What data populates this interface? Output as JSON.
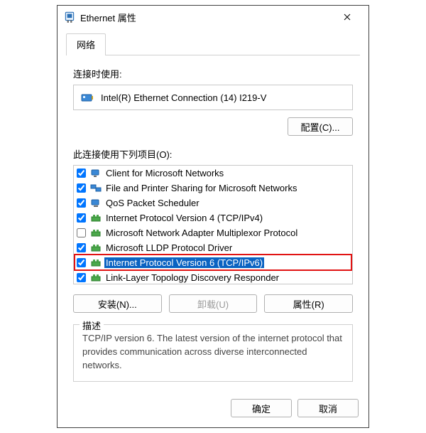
{
  "window": {
    "title": "Ethernet 属性",
    "close_tooltip": "关闭"
  },
  "tab": {
    "network": "网络"
  },
  "labels": {
    "connect_using": "连接时使用:",
    "this_connection_uses": "此连接使用下列项目(O):"
  },
  "adapter": {
    "name": "Intel(R) Ethernet Connection (14) I219-V"
  },
  "buttons": {
    "configure": "配置(C)...",
    "install": "安装(N)...",
    "uninstall": "卸载(U)",
    "properties": "属性(R)",
    "ok": "确定",
    "cancel": "取消"
  },
  "items": [
    {
      "label": "Client for Microsoft Networks",
      "checked": true,
      "icon": "client"
    },
    {
      "label": "File and Printer Sharing for Microsoft Networks",
      "checked": true,
      "icon": "share"
    },
    {
      "label": "QoS Packet Scheduler",
      "checked": true,
      "icon": "qos"
    },
    {
      "label": "Internet Protocol Version 4 (TCP/IPv4)",
      "checked": true,
      "icon": "proto"
    },
    {
      "label": "Microsoft Network Adapter Multiplexor Protocol",
      "checked": false,
      "icon": "proto"
    },
    {
      "label": "Microsoft LLDP Protocol Driver",
      "checked": true,
      "icon": "proto"
    },
    {
      "label": "Internet Protocol Version 6 (TCP/IPv6)",
      "checked": true,
      "icon": "proto",
      "selected": true,
      "highlighted": true
    },
    {
      "label": "Link-Layer Topology Discovery Responder",
      "checked": true,
      "icon": "proto"
    }
  ],
  "description": {
    "title": "描述",
    "text": "TCP/IP version 6. The latest version of the internet protocol that provides communication across diverse interconnected networks."
  }
}
